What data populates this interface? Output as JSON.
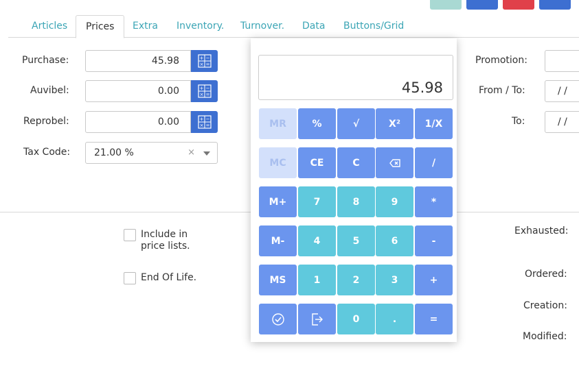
{
  "tabs": [
    {
      "label": "Articles"
    },
    {
      "label": "Prices"
    },
    {
      "label": "Extra"
    },
    {
      "label": "Inventory."
    },
    {
      "label": "Turnover."
    },
    {
      "label": "Data"
    },
    {
      "label": "Buttons/Grid"
    }
  ],
  "active_tab": "Prices",
  "form": {
    "purchase_label": "Purchase:",
    "purchase_value": "45.98",
    "auvibel_label": "Auvibel:",
    "auvibel_value": "0.00",
    "reprobel_label": "Reprobel:",
    "reprobel_value": "0.00",
    "tax_label": "Tax Code:",
    "tax_value": "21.00 %",
    "tax_clear": "×",
    "include_label_1": "Include in",
    "include_label_2": "price lists.",
    "eol_label": "End Of Life."
  },
  "right": {
    "promotion_label": "Promotion:",
    "from_to_label": "From / To:",
    "from_value": "/ /",
    "to_label": "To:",
    "to_value": "/ /",
    "exhausted_label": "Exhausted:",
    "ordered_label": "Ordered:",
    "creation_label": "Creation:",
    "modified_label": "Modified:"
  },
  "calculator": {
    "display": "45.98",
    "rows": [
      [
        "MR",
        "%",
        "√",
        "X²",
        "1/X"
      ],
      [
        "MC",
        "CE",
        "C",
        "⌫",
        "/"
      ],
      [
        "M+",
        "7",
        "8",
        "9",
        "*"
      ],
      [
        "M-",
        "4",
        "5",
        "6",
        "-"
      ],
      [
        "MS",
        "1",
        "2",
        "3",
        "+"
      ],
      [
        "ok-icon",
        "exit-icon",
        "0",
        ".",
        "="
      ]
    ]
  },
  "colors": {
    "accent_blue": "#3d6fd1",
    "key_blue": "#6b95ee",
    "key_teal": "#5fc9dd",
    "tab_teal": "#3ba5b5"
  }
}
